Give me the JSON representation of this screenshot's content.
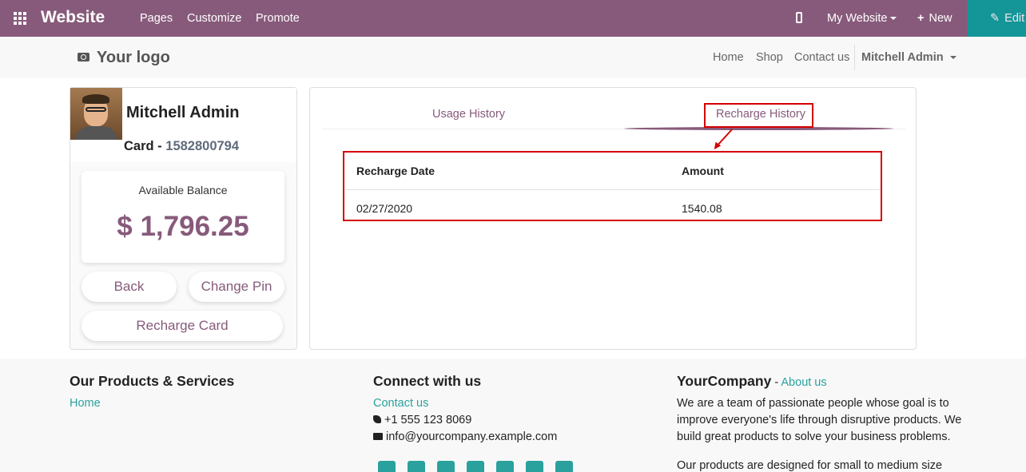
{
  "adminbar": {
    "brand": "Website",
    "menu": [
      "Pages",
      "Customize",
      "Promote"
    ],
    "site_selector": "My Website",
    "new_label": "New",
    "edit_label": "Edit"
  },
  "navbar": {
    "logo": "Your logo",
    "links": [
      "Home",
      "Shop",
      "Contact us"
    ],
    "user": "Mitchell Admin"
  },
  "profile": {
    "name": "Mitchell Admin",
    "card_label": "Card - ",
    "card_number": "1582800794",
    "balance_label": "Available Balance",
    "balance_value": "$ 1,796.25",
    "buttons": {
      "back": "Back",
      "change_pin": "Change Pin",
      "recharge": "Recharge Card"
    }
  },
  "tabs": {
    "usage": "Usage History",
    "recharge": "Recharge History",
    "active": "recharge"
  },
  "recharge_table": {
    "headers": [
      "Recharge Date",
      "Amount"
    ],
    "rows": [
      [
        "02/27/2020",
        "1540.08"
      ]
    ]
  },
  "footer": {
    "col1": {
      "title": "Our Products & Services",
      "link": "Home"
    },
    "col2": {
      "title": "Connect with us",
      "contact": "Contact us",
      "phone": "+1 555 123 8069",
      "email": "info@yourcompany.example.com"
    },
    "col3": {
      "company": "YourCompany",
      "sep": " - ",
      "about": "About us",
      "lines": [
        "We are a team of passionate people whose goal is to",
        "improve everyone's life through disruptive products. We",
        "build great products to solve your business problems.",
        "Our products are designed for small to medium size"
      ]
    },
    "social_icons": [
      "facebook-icon",
      "twitter-icon",
      "linkedin-icon",
      "youtube-icon",
      "googleplus-icon",
      "github-icon",
      "instagram-icon"
    ]
  },
  "colors": {
    "brand": "#875a7b",
    "teal": "#00a09d",
    "highlight": "#d40000"
  }
}
